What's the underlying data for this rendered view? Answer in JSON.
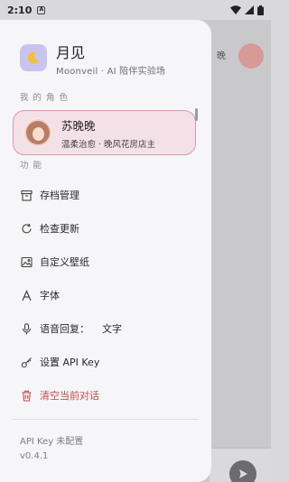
{
  "status_bar": {
    "time": "2:10",
    "notification": "A"
  },
  "background_chat": {
    "title_fragment": "晚"
  },
  "app": {
    "title": "月见",
    "subtitle": "Moonveil · AI 陪伴实验场"
  },
  "sections": {
    "roles_label": "我 的 角 色",
    "functions_label": "功 能"
  },
  "role": {
    "name": "苏晚晚",
    "description": "温柔治愈 · 晚风花房店主"
  },
  "menu": [
    {
      "label": "存档管理",
      "icon": "archive-icon"
    },
    {
      "label": "检查更新",
      "icon": "refresh-icon"
    },
    {
      "label": "自定义壁纸",
      "icon": "image-icon"
    },
    {
      "label": "字体",
      "icon": "font-icon"
    },
    {
      "label": "语音回复：",
      "value": "文字",
      "icon": "microphone-icon"
    },
    {
      "label": "设置 API Key",
      "icon": "key-icon"
    },
    {
      "label": "清空当前对话",
      "icon": "trash-icon",
      "color": "#c54a4a"
    }
  ],
  "footer": {
    "api_status": "API Key 未配置",
    "version": "v0.4.1"
  },
  "colors": {
    "accent_pink": "#f3e1e7",
    "accent_border": "#d99aab",
    "logo_bg": "#c9c3ef",
    "danger": "#c54a4a"
  }
}
